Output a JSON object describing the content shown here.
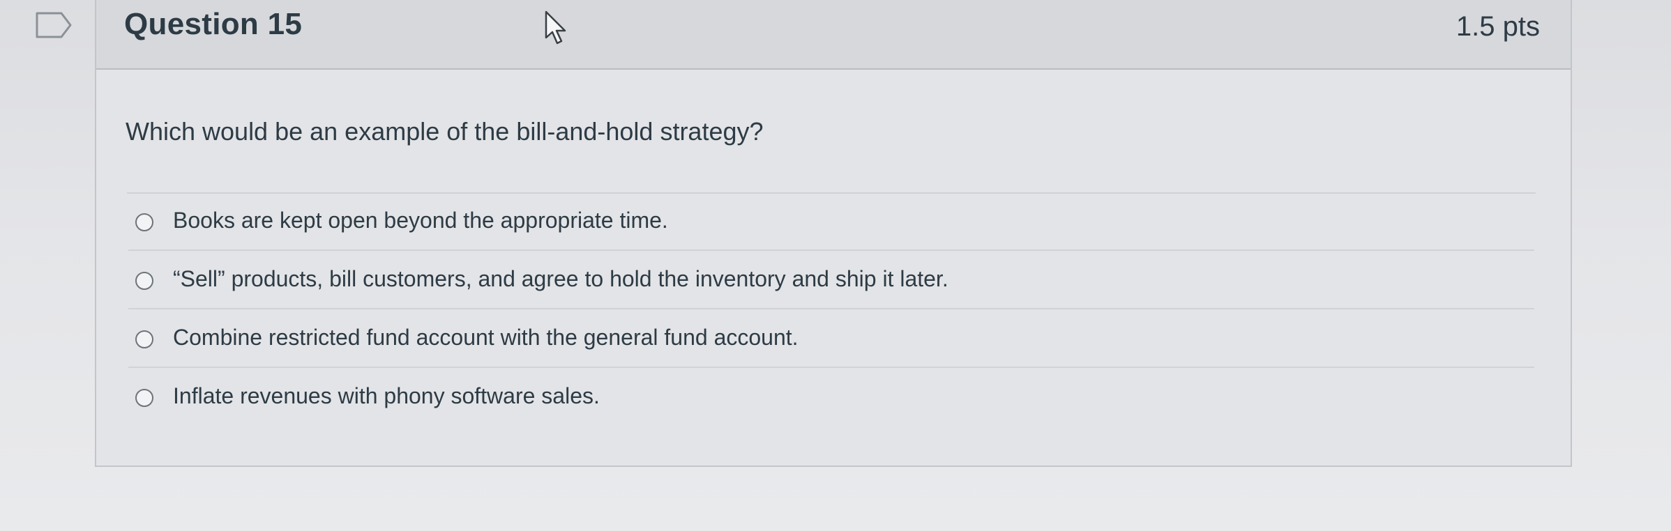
{
  "question": {
    "title": "Question 15",
    "points": "1.5 pts",
    "text": "Which would be an example of the bill-and-hold strategy?",
    "answers": [
      "Books are kept open beyond the appropriate time.",
      "“Sell” products, bill customers, and agree to hold the inventory and ship it later.",
      "Combine restricted fund account with the general fund account.",
      "Inflate revenues with phony software sales."
    ]
  },
  "icons": {
    "flag": "bookmark-flag-icon",
    "cursor": "mouse-pointer-icon",
    "radio": "radio-button-unselected"
  },
  "colors": {
    "text": "#2d3b45",
    "header_background": "#d6d8dc",
    "card_background": "#e3e4e7",
    "border": "#c2c5c9"
  }
}
